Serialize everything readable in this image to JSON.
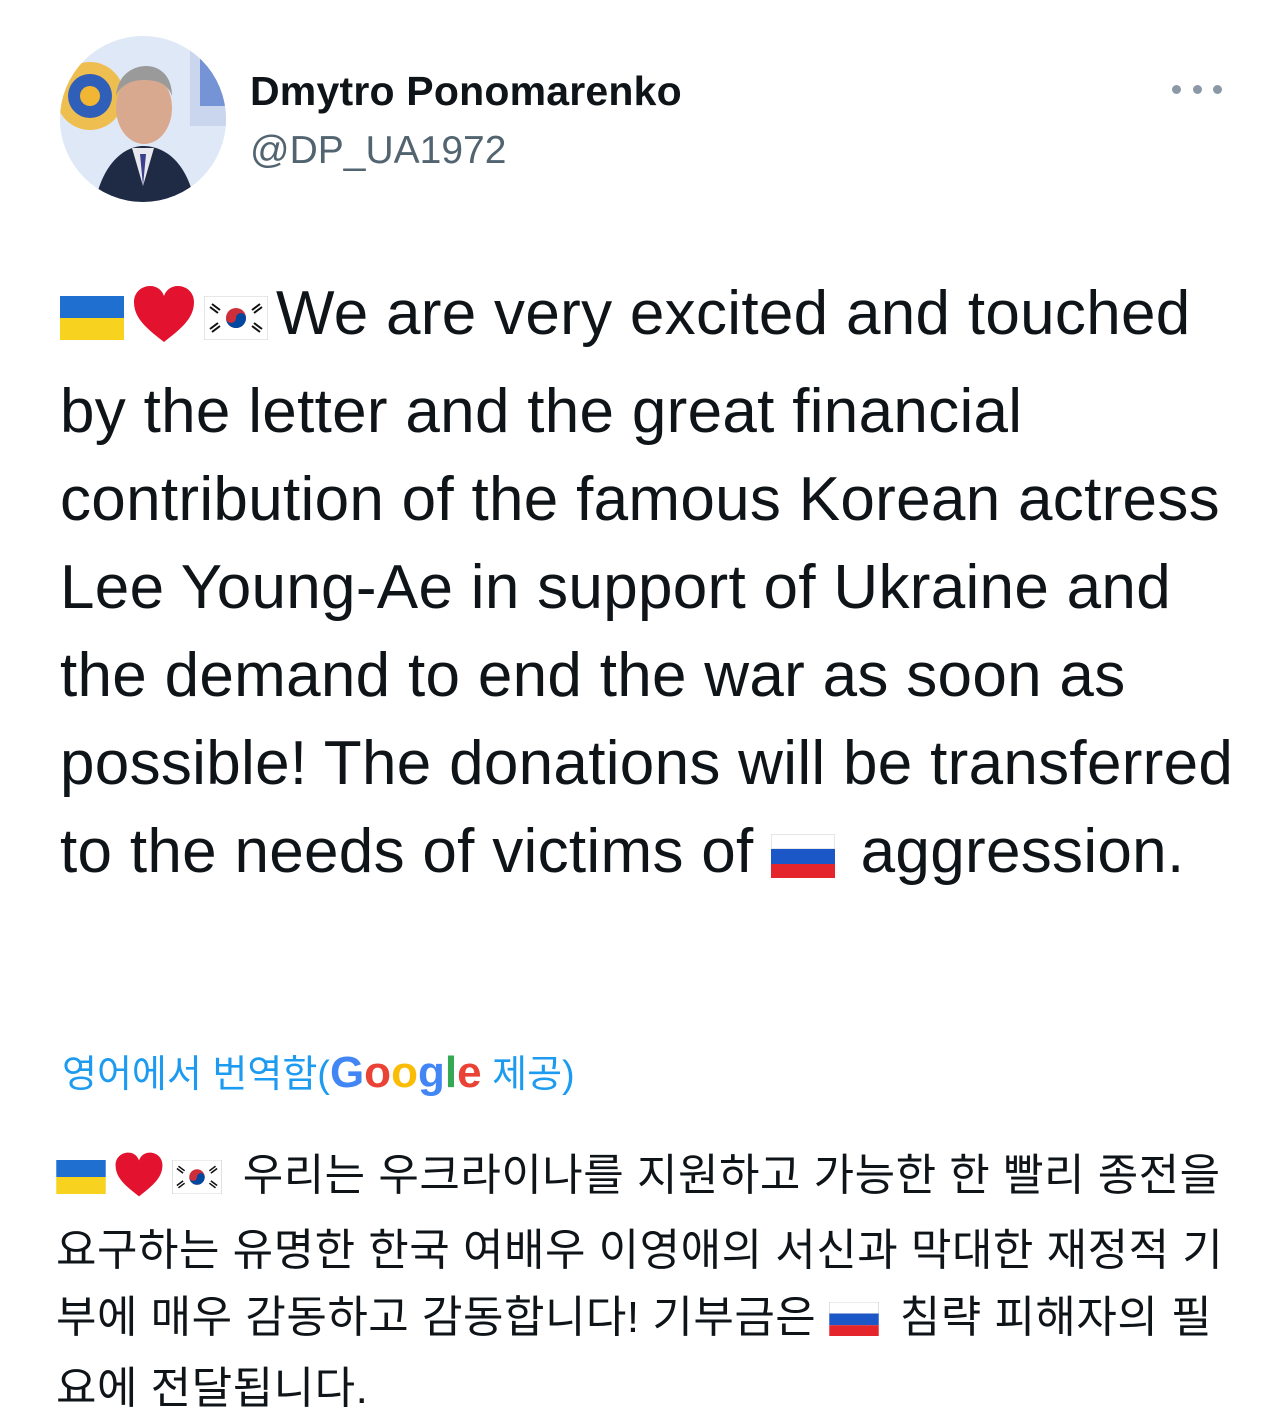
{
  "author": {
    "display_name": "Dmytro Ponomarenko",
    "handle": "@DP_UA1972"
  },
  "tweet": {
    "emoji_prefix": [
      "ukraine-flag",
      "red-heart",
      "south-korea-flag"
    ],
    "text_part1": "We are very excited and touched by the letter and the great financial contribution of the famous Korean actress Lee Young-Ae in support of Ukraine and the demand to end the war as soon as possible! The donations will be transferred to the needs of victims of",
    "text_part2": " aggression."
  },
  "translation": {
    "link_prefix": "영어에서 번역함(",
    "google": "Google",
    "link_suffix": " 제공)",
    "text_part1": " 우리는 우크라이나를 지원하고 가능한 한 빨리 종전을 요구하는 유명한 한국 여배우 이영애의 서신과 막대한 재정적 기부에 매우 감동하고 감동합니다! 기부금은",
    "text_part2": " 침략 피해자의 필요에 전달됩니다."
  },
  "colors": {
    "link": "#1d9bf0",
    "secondary_text": "#536471",
    "primary_text": "#0f1419"
  },
  "icons": [
    "more-options-icon"
  ]
}
